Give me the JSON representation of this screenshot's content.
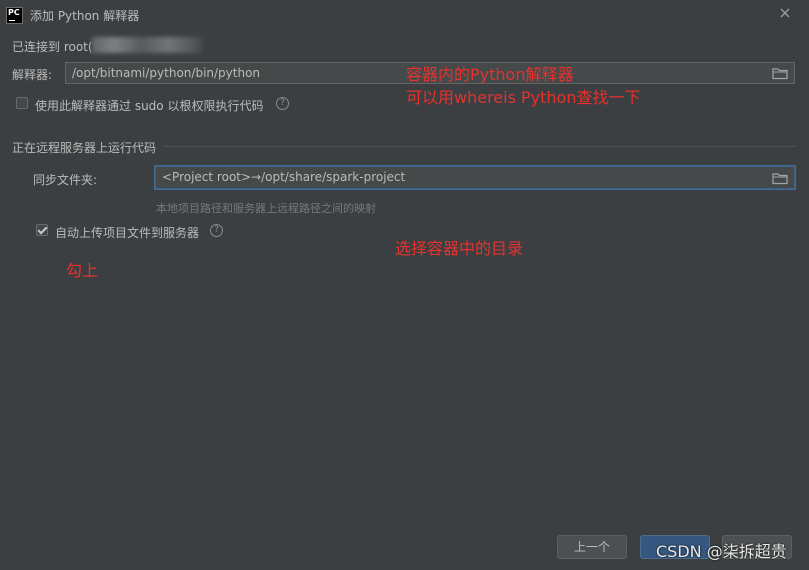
{
  "window": {
    "title": "添加 Python 解释器",
    "logo_text": "PC"
  },
  "connection": {
    "text": "已连接到 root("
  },
  "interpreter": {
    "label": "解释器:",
    "path": "/opt/bitnami/python/bin/python"
  },
  "sudo_option": {
    "label": "使用此解释器通过 sudo 以根权限执行代码",
    "checked": false,
    "help": "?"
  },
  "remote_section": {
    "title": "正在远程服务器上运行代码",
    "sync_label": "同步文件夹:",
    "sync_value": "<Project root>→/opt/share/spark-project",
    "hint": "本地项目路径和服务器上远程路径之间的映射"
  },
  "auto_upload": {
    "label": "自动上传项目文件到服务器",
    "checked": true,
    "help": "?"
  },
  "annotations": {
    "interpreter_note_1": "容器内的Python解释器",
    "interpreter_note_2": "可以用whereis Python查找一下",
    "directory_note": "选择容器中的目录",
    "check_note": "勾上"
  },
  "buttons": {
    "previous": "上一个",
    "next": "",
    "cancel": ""
  },
  "watermark": "CSDN @柒拆超贵",
  "colors": {
    "background": "#3c3f41",
    "field_bg": "#45494a",
    "annotation_red": "#e5322d",
    "primary_button": "#365880"
  },
  "icons": [
    "pycharm-logo",
    "close-icon",
    "folder-icon",
    "help-icon",
    "checkbox-checked-icon",
    "checkbox-unchecked-icon"
  ]
}
